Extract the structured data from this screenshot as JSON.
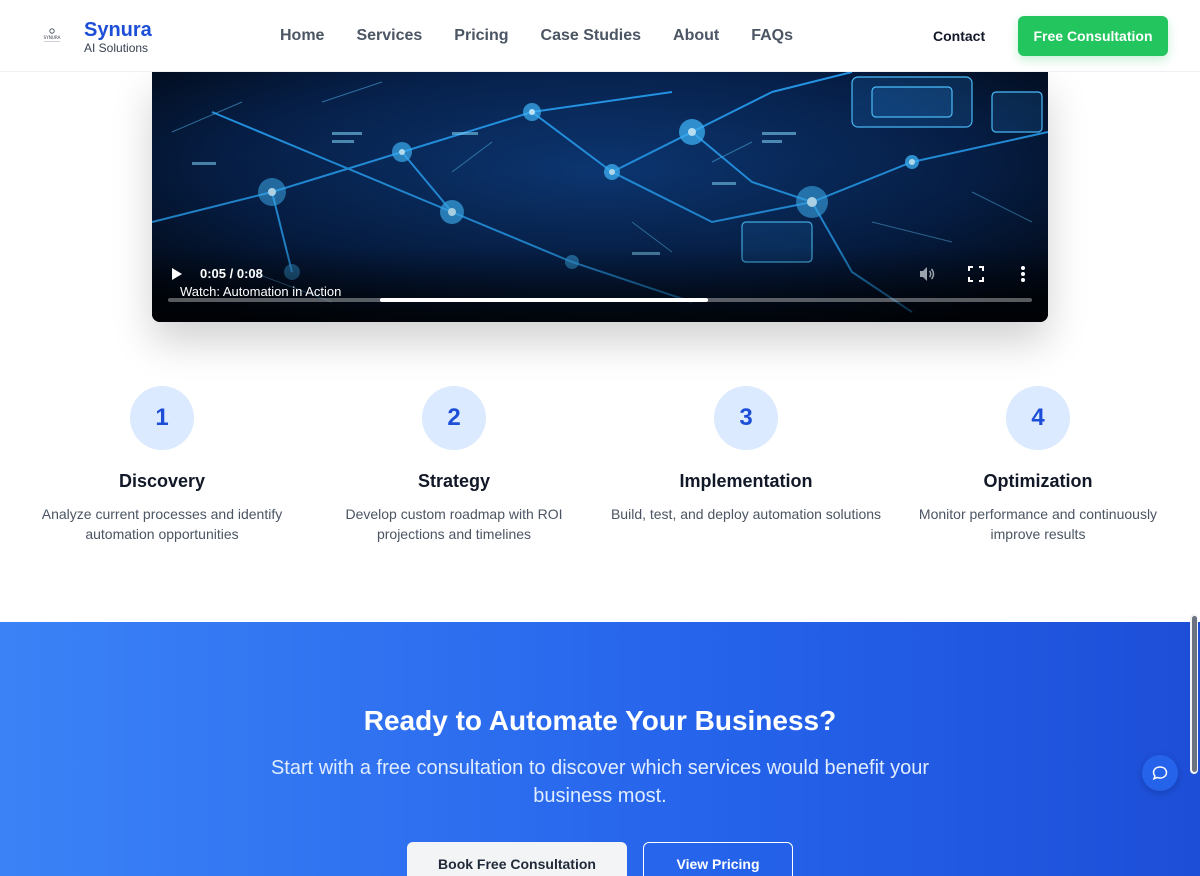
{
  "header": {
    "logo_small_text": "SYNURA",
    "brand_name": "Synura",
    "brand_tagline": "AI Solutions",
    "nav": [
      "Home",
      "Services",
      "Pricing",
      "Case Studies",
      "About",
      "FAQs"
    ],
    "contact_label": "Contact",
    "cta_label": "Free Consultation"
  },
  "video": {
    "time": "0:05 / 0:08",
    "caption": "Watch: Automation in Action",
    "progress": 0.625
  },
  "steps": [
    {
      "number": "1",
      "title": "Discovery",
      "description": "Analyze current processes and identify automation opportunities"
    },
    {
      "number": "2",
      "title": "Strategy",
      "description": "Develop custom roadmap with ROI projections and timelines"
    },
    {
      "number": "3",
      "title": "Implementation",
      "description": "Build, test, and deploy automation solutions"
    },
    {
      "number": "4",
      "title": "Optimization",
      "description": "Monitor performance and continuously improve results"
    }
  ],
  "cta": {
    "title": "Ready to Automate Your Business?",
    "subtitle": "Start with a free consultation to discover which services would benefit your business most.",
    "primary_label": "Book Free Consultation",
    "secondary_label": "View Pricing"
  },
  "colors": {
    "brand": "#1d4ed8",
    "cta_green": "#22c55e",
    "band_start": "#3b82f6",
    "band_end": "#1d4ed8"
  }
}
